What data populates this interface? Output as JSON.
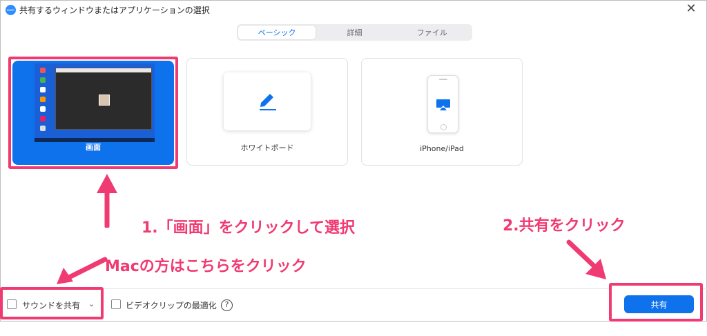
{
  "window": {
    "title": "共有するウィンドウまたはアプリケーションの選択",
    "app_icon_text": "zoom"
  },
  "tabs": [
    {
      "label": "ベーシック",
      "active": true
    },
    {
      "label": "詳細",
      "active": false
    },
    {
      "label": "ファイル",
      "active": false
    }
  ],
  "sources": [
    {
      "label": "画面",
      "icon": "desktop-thumbnail",
      "selected": true
    },
    {
      "label": "ホワイトボード",
      "icon": "pen-icon",
      "selected": false
    },
    {
      "label": "iPhone/iPad",
      "icon": "airplay-phone-icon",
      "selected": false
    }
  ],
  "annotations": {
    "step1": "1.「画面」をクリックして選択",
    "step2": "2.共有をクリック",
    "mac": "Macの方はこちらをクリック"
  },
  "bottom": {
    "share_sound_label": "サウンドを共有",
    "optimize_video_label": "ビデオクリップの最適化",
    "help_symbol": "?",
    "share_button": "共有"
  },
  "colors": {
    "accent": "#0e72ed",
    "annotation": "#f03a72"
  }
}
